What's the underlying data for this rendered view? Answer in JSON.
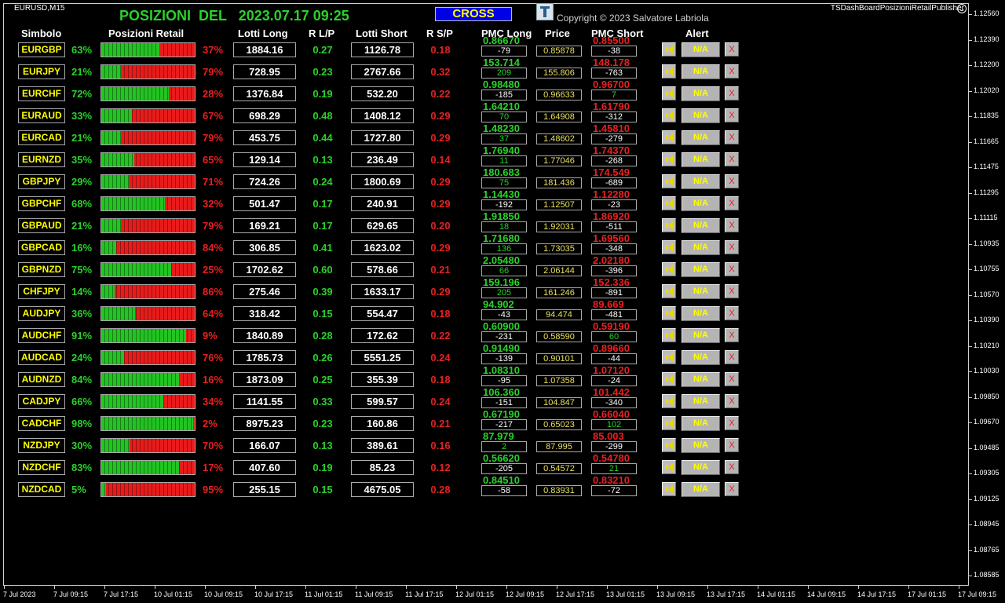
{
  "chart": {
    "symbol_tf": "EURUSD,M15",
    "indicator": "TSDashBoardPosizioniRetailPublisher",
    "y_labels": [
      "1.12560",
      "1.12390",
      "1.12200",
      "1.12020",
      "1.11835",
      "1.11665",
      "1.11475",
      "1.11295",
      "1.11115",
      "1.10935",
      "1.10755",
      "1.10570",
      "1.10390",
      "1.10210",
      "1.10030",
      "1.09850",
      "1.09670",
      "1.09485",
      "1.09305",
      "1.09125",
      "1.08945",
      "1.08765",
      "1.08585"
    ],
    "x_labels": [
      "7 Jul 2023",
      "7 Jul 09:15",
      "7 Jul 17:15",
      "10 Jul 01:15",
      "10 Jul 09:15",
      "10 Jul 17:15",
      "11 Jul 01:15",
      "11 Jul 09:15",
      "11 Jul 17:15",
      "12 Jul 01:15",
      "12 Jul 09:15",
      "12 Jul 17:15",
      "13 Jul 01:15",
      "13 Jul 09:15",
      "13 Jul 17:15",
      "14 Jul 01:15",
      "14 Jul 09:15",
      "14 Jul 17:15",
      "17 Jul 01:15",
      "17 Jul 09:15"
    ]
  },
  "header": {
    "title": "POSIZIONI  DEL   2023.07.17 09:25",
    "cross": "CROSS",
    "copyright": "Copyright © 2023 Salvatore Labriola",
    "logo_icon": "ts-logo-icon"
  },
  "columns": {
    "simbolo": "Simbolo",
    "posizioni": "Posizioni Retail",
    "lotti_long": "Lotti Long",
    "rlp": "R L/P",
    "lotti_short": "Lotti Short",
    "rsp": "R S/P",
    "pmc_long": "PMC Long",
    "price": "Price",
    "pmc_short": "PMC Short",
    "alert": "Alert"
  },
  "colors": {
    "long": "#2ad12a",
    "short": "#e82020",
    "symbol": "#ffff00",
    "price": "#e8e060"
  },
  "rows": [
    {
      "symbol": "EURGBP",
      "long_pct": "63%",
      "short_pct": "37%",
      "long_value": 63,
      "lotti_long": "1884.16",
      "rlp": "0.27",
      "lotti_short": "1126.78",
      "rsp": "0.18",
      "pmc_long": "0.86670",
      "pmc_long_diff": "-79",
      "price": "0.85878",
      "pmc_short": "0.85500",
      "pmc_short_diff": "-38",
      "alert": "N/A",
      "close": "X"
    },
    {
      "symbol": "EURJPY",
      "long_pct": "21%",
      "short_pct": "79%",
      "long_value": 21,
      "lotti_long": "728.95",
      "rlp": "0.23",
      "lotti_short": "2767.66",
      "rsp": "0.32",
      "pmc_long": "153.714",
      "pmc_long_diff": "209",
      "price": "155.806",
      "pmc_short": "148.178",
      "pmc_short_diff": "-763",
      "alert": "N/A",
      "close": "X"
    },
    {
      "symbol": "EURCHF",
      "long_pct": "72%",
      "short_pct": "28%",
      "long_value": 72,
      "lotti_long": "1376.84",
      "rlp": "0.19",
      "lotti_short": "532.20",
      "rsp": "0.22",
      "pmc_long": "0.98480",
      "pmc_long_diff": "-185",
      "price": "0.96633",
      "pmc_short": "0.96700",
      "pmc_short_diff": "7",
      "alert": "N/A",
      "close": "X"
    },
    {
      "symbol": "EURAUD",
      "long_pct": "33%",
      "short_pct": "67%",
      "long_value": 33,
      "lotti_long": "698.29",
      "rlp": "0.48",
      "lotti_short": "1408.12",
      "rsp": "0.29",
      "pmc_long": "1.64210",
      "pmc_long_diff": "70",
      "price": "1.64908",
      "pmc_short": "1.61790",
      "pmc_short_diff": "-312",
      "alert": "N/A",
      "close": "X"
    },
    {
      "symbol": "EURCAD",
      "long_pct": "21%",
      "short_pct": "79%",
      "long_value": 21,
      "lotti_long": "453.75",
      "rlp": "0.44",
      "lotti_short": "1727.80",
      "rsp": "0.29",
      "pmc_long": "1.48230",
      "pmc_long_diff": "37",
      "price": "1.48602",
      "pmc_short": "1.45810",
      "pmc_short_diff": "-279",
      "alert": "N/A",
      "close": "X"
    },
    {
      "symbol": "EURNZD",
      "long_pct": "35%",
      "short_pct": "65%",
      "long_value": 35,
      "lotti_long": "129.14",
      "rlp": "0.13",
      "lotti_short": "236.49",
      "rsp": "0.14",
      "pmc_long": "1.76940",
      "pmc_long_diff": "11",
      "price": "1.77046",
      "pmc_short": "1.74370",
      "pmc_short_diff": "-268",
      "alert": "N/A",
      "close": "X"
    },
    {
      "symbol": "GBPJPY",
      "long_pct": "29%",
      "short_pct": "71%",
      "long_value": 29,
      "lotti_long": "724.26",
      "rlp": "0.24",
      "lotti_short": "1800.69",
      "rsp": "0.29",
      "pmc_long": "180.683",
      "pmc_long_diff": "75",
      "price": "181.436",
      "pmc_short": "174.549",
      "pmc_short_diff": "-689",
      "alert": "N/A",
      "close": "X"
    },
    {
      "symbol": "GBPCHF",
      "long_pct": "68%",
      "short_pct": "32%",
      "long_value": 68,
      "lotti_long": "501.47",
      "rlp": "0.17",
      "lotti_short": "240.91",
      "rsp": "0.29",
      "pmc_long": "1.14430",
      "pmc_long_diff": "-192",
      "price": "1.12507",
      "pmc_short": "1.12280",
      "pmc_short_diff": "-23",
      "alert": "N/A",
      "close": "X"
    },
    {
      "symbol": "GBPAUD",
      "long_pct": "21%",
      "short_pct": "79%",
      "long_value": 21,
      "lotti_long": "169.21",
      "rlp": "0.17",
      "lotti_short": "629.65",
      "rsp": "0.20",
      "pmc_long": "1.91850",
      "pmc_long_diff": "18",
      "price": "1.92031",
      "pmc_short": "1.86920",
      "pmc_short_diff": "-511",
      "alert": "N/A",
      "close": "X"
    },
    {
      "symbol": "GBPCAD",
      "long_pct": "16%",
      "short_pct": "84%",
      "long_value": 16,
      "lotti_long": "306.85",
      "rlp": "0.41",
      "lotti_short": "1623.02",
      "rsp": "0.29",
      "pmc_long": "1.71680",
      "pmc_long_diff": "136",
      "price": "1.73035",
      "pmc_short": "1.69560",
      "pmc_short_diff": "-348",
      "alert": "N/A",
      "close": "X"
    },
    {
      "symbol": "GBPNZD",
      "long_pct": "75%",
      "short_pct": "25%",
      "long_value": 75,
      "lotti_long": "1702.62",
      "rlp": "0.60",
      "lotti_short": "578.66",
      "rsp": "0.21",
      "pmc_long": "2.05480",
      "pmc_long_diff": "66",
      "price": "2.06144",
      "pmc_short": "2.02180",
      "pmc_short_diff": "-396",
      "alert": "N/A",
      "close": "X"
    },
    {
      "symbol": "CHFJPY",
      "long_pct": "14%",
      "short_pct": "86%",
      "long_value": 14,
      "lotti_long": "275.46",
      "rlp": "0.39",
      "lotti_short": "1633.17",
      "rsp": "0.29",
      "pmc_long": "159.196",
      "pmc_long_diff": "205",
      "price": "161.246",
      "pmc_short": "152.336",
      "pmc_short_diff": "-891",
      "alert": "N/A",
      "close": "X"
    },
    {
      "symbol": "AUDJPY",
      "long_pct": "36%",
      "short_pct": "64%",
      "long_value": 36,
      "lotti_long": "318.42",
      "rlp": "0.15",
      "lotti_short": "554.47",
      "rsp": "0.18",
      "pmc_long": "94.902",
      "pmc_long_diff": "-43",
      "price": "94.474",
      "pmc_short": "89.669",
      "pmc_short_diff": "-481",
      "alert": "N/A",
      "close": "X"
    },
    {
      "symbol": "AUDCHF",
      "long_pct": "91%",
      "short_pct": "9%",
      "long_value": 91,
      "lotti_long": "1840.89",
      "rlp": "0.28",
      "lotti_short": "172.62",
      "rsp": "0.22",
      "pmc_long": "0.60900",
      "pmc_long_diff": "-231",
      "price": "0.58590",
      "pmc_short": "0.59190",
      "pmc_short_diff": "60",
      "alert": "N/A",
      "close": "X"
    },
    {
      "symbol": "AUDCAD",
      "long_pct": "24%",
      "short_pct": "76%",
      "long_value": 24,
      "lotti_long": "1785.73",
      "rlp": "0.26",
      "lotti_short": "5551.25",
      "rsp": "0.24",
      "pmc_long": "0.91490",
      "pmc_long_diff": "-139",
      "price": "0.90101",
      "pmc_short": "0.89660",
      "pmc_short_diff": "-44",
      "alert": "N/A",
      "close": "X"
    },
    {
      "symbol": "AUDNZD",
      "long_pct": "84%",
      "short_pct": "16%",
      "long_value": 84,
      "lotti_long": "1873.09",
      "rlp": "0.25",
      "lotti_short": "355.39",
      "rsp": "0.18",
      "pmc_long": "1.08310",
      "pmc_long_diff": "-95",
      "price": "1.07358",
      "pmc_short": "1.07120",
      "pmc_short_diff": "-24",
      "alert": "N/A",
      "close": "X"
    },
    {
      "symbol": "CADJPY",
      "long_pct": "66%",
      "short_pct": "34%",
      "long_value": 66,
      "lotti_long": "1141.55",
      "rlp": "0.33",
      "lotti_short": "599.57",
      "rsp": "0.24",
      "pmc_long": "106.360",
      "pmc_long_diff": "-151",
      "price": "104.847",
      "pmc_short": "101.442",
      "pmc_short_diff": "-340",
      "alert": "N/A",
      "close": "X"
    },
    {
      "symbol": "CADCHF",
      "long_pct": "98%",
      "short_pct": "2%",
      "long_value": 98,
      "lotti_long": "8975.23",
      "rlp": "0.23",
      "lotti_short": "160.86",
      "rsp": "0.21",
      "pmc_long": "0.67190",
      "pmc_long_diff": "-217",
      "price": "0.65023",
      "pmc_short": "0.66040",
      "pmc_short_diff": "102",
      "alert": "N/A",
      "close": "X"
    },
    {
      "symbol": "NZDJPY",
      "long_pct": "30%",
      "short_pct": "70%",
      "long_value": 30,
      "lotti_long": "166.07",
      "rlp": "0.13",
      "lotti_short": "389.61",
      "rsp": "0.16",
      "pmc_long": "87.979",
      "pmc_long_diff": "2",
      "price": "87.995",
      "pmc_short": "85.003",
      "pmc_short_diff": "-299",
      "alert": "N/A",
      "close": "X"
    },
    {
      "symbol": "NZDCHF",
      "long_pct": "83%",
      "short_pct": "17%",
      "long_value": 83,
      "lotti_long": "407.60",
      "rlp": "0.19",
      "lotti_short": "85.23",
      "rsp": "0.12",
      "pmc_long": "0.56620",
      "pmc_long_diff": "-205",
      "price": "0.54572",
      "pmc_short": "0.54780",
      "pmc_short_diff": "21",
      "alert": "N/A",
      "close": "X"
    },
    {
      "symbol": "NZDCAD",
      "long_pct": "5%",
      "short_pct": "95%",
      "long_value": 5,
      "lotti_long": "255.15",
      "rlp": "0.15",
      "lotti_short": "4675.05",
      "rsp": "0.28",
      "pmc_long": "0.84510",
      "pmc_long_diff": "-58",
      "price": "0.83931",
      "pmc_short": "0.83210",
      "pmc_short_diff": "-72",
      "alert": "N/A",
      "close": "X"
    }
  ]
}
